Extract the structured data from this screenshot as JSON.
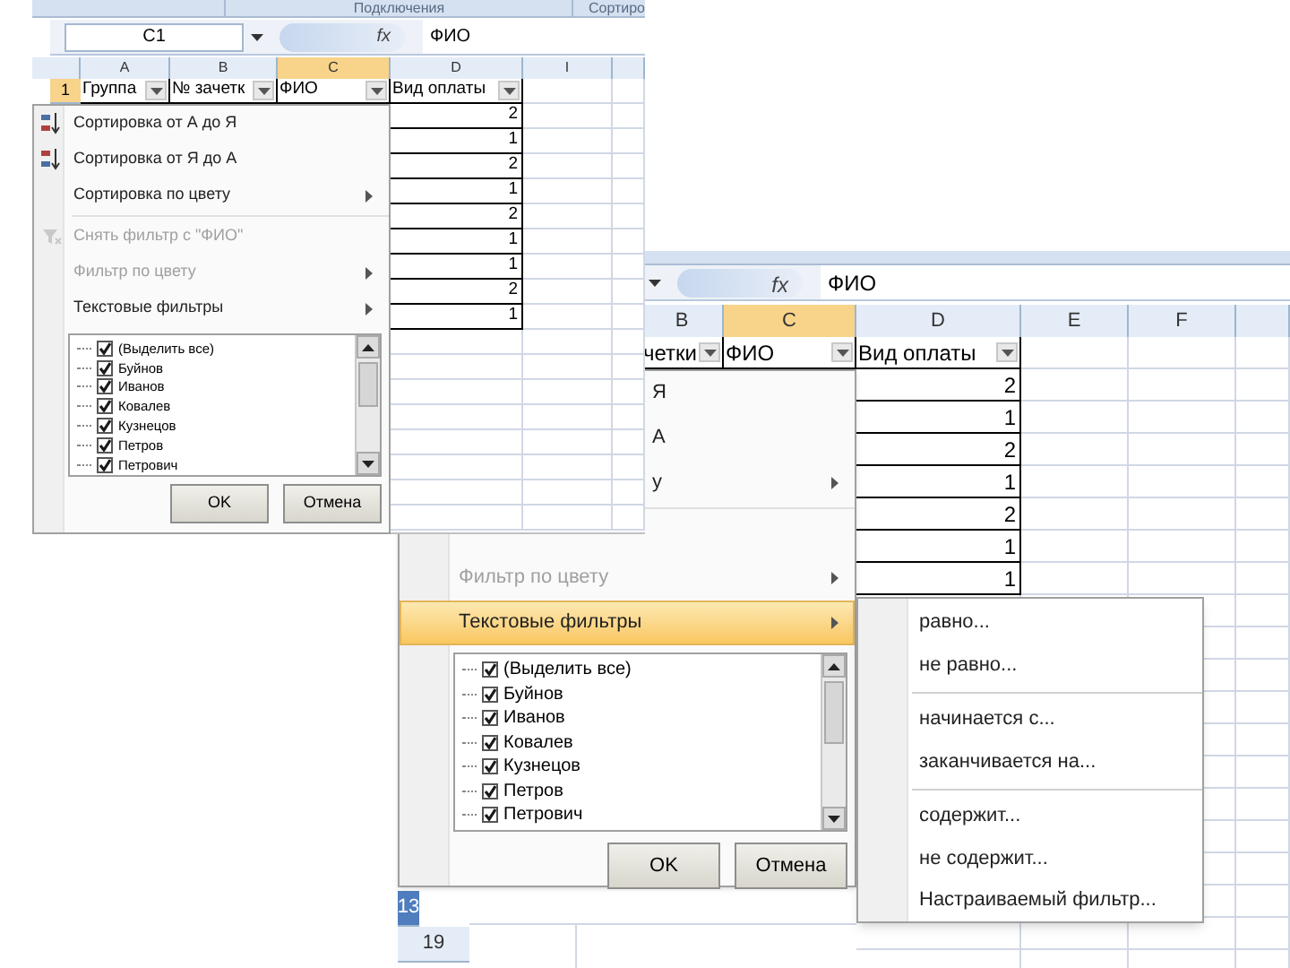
{
  "back_window": {
    "formula_bar": {
      "fx_label": "fx",
      "formula": "ФИО"
    },
    "column_headers": [
      {
        "label": "B",
        "selected": false
      },
      {
        "label": "C",
        "selected": true
      },
      {
        "label": "D",
        "selected": false
      },
      {
        "label": "E",
        "selected": false
      },
      {
        "label": "F",
        "selected": false
      }
    ],
    "header_row": [
      "четки",
      "ФИО",
      "Вид оплаты"
    ],
    "column_d_values": [
      "2",
      "1",
      "2",
      "1",
      "2",
      "1",
      "1"
    ],
    "filter_menu": {
      "items": [
        {
          "kind": "fragment",
          "label": "Я",
          "disabled": false,
          "selected": false,
          "has_submenu": false
        },
        {
          "kind": "fragment",
          "label": "А",
          "disabled": false,
          "selected": false,
          "has_submenu": false
        },
        {
          "kind": "fragment",
          "label": "у",
          "disabled": false,
          "selected": false,
          "has_submenu": true
        },
        {
          "kind": "separator"
        },
        {
          "kind": "plain",
          "label": "Фильтр по цвету",
          "disabled": true,
          "selected": false,
          "has_submenu": true
        },
        {
          "kind": "plain",
          "label": "Текстовые фильтры",
          "disabled": false,
          "selected": true,
          "has_submenu": true
        }
      ],
      "list": [
        {
          "label": "(Выделить все)",
          "checked": true
        },
        {
          "label": "Буйнов",
          "checked": true
        },
        {
          "label": "Иванов",
          "checked": true
        },
        {
          "label": "Ковалев",
          "checked": true
        },
        {
          "label": "Кузнецов",
          "checked": true
        },
        {
          "label": "Петров",
          "checked": true
        },
        {
          "label": "Петрович",
          "checked": true
        }
      ],
      "buttons": [
        "OK",
        "Отмена"
      ]
    },
    "text_filter_submenu": [
      {
        "kind": "item",
        "label": "равно..."
      },
      {
        "kind": "item",
        "label": "не равно..."
      },
      {
        "kind": "separator"
      },
      {
        "kind": "item",
        "label": "начинается с..."
      },
      {
        "kind": "item",
        "label": "заканчивается на..."
      },
      {
        "kind": "separator"
      },
      {
        "kind": "item",
        "label": "содержит..."
      },
      {
        "kind": "item",
        "label": "не содержит..."
      },
      {
        "kind": "item",
        "label": "Настраиваемый фильтр..."
      }
    ],
    "row_headers": [
      {
        "label": "13",
        "selected": true
      },
      {
        "label": "19",
        "selected": false
      }
    ]
  },
  "front_window": {
    "ribbon_tabs": [
      "Подключения",
      "Сортиро"
    ],
    "formula_bar": {
      "name_box": "C1",
      "fx_label": "fx",
      "formula": "ФИО"
    },
    "column_headers": [
      {
        "label": "A",
        "selected": false
      },
      {
        "label": "B",
        "selected": false
      },
      {
        "label": "C",
        "selected": true
      },
      {
        "label": "D",
        "selected": false
      },
      {
        "label": "I",
        "selected": false
      }
    ],
    "row_header": {
      "label": "1",
      "selected": true
    },
    "header_row": [
      "Группа",
      "№ зачетк",
      "ФИО",
      "Вид оплаты"
    ],
    "column_d_values": [
      "2",
      "1",
      "2",
      "1",
      "2",
      "1",
      "1",
      "2",
      "1"
    ],
    "filter_menu": {
      "items": [
        {
          "kind": "sort-asc",
          "label": "Сортировка от А до Я",
          "disabled": false,
          "selected": false,
          "has_submenu": false
        },
        {
          "kind": "sort-desc",
          "label": "Сортировка от Я до А",
          "disabled": false,
          "selected": false,
          "has_submenu": false
        },
        {
          "kind": "plain",
          "label": "Сортировка по цвету",
          "disabled": false,
          "selected": false,
          "has_submenu": true
        },
        {
          "kind": "separator"
        },
        {
          "kind": "clear-filter",
          "label": "Снять фильтр с \"ФИО\"",
          "disabled": true,
          "selected": false,
          "has_submenu": false
        },
        {
          "kind": "plain",
          "label": "Фильтр по цвету",
          "disabled": true,
          "selected": false,
          "has_submenu": true
        },
        {
          "kind": "plain",
          "label": "Текстовые фильтры",
          "disabled": false,
          "selected": false,
          "has_submenu": true
        }
      ],
      "list": [
        {
          "label": "(Выделить все)",
          "checked": true
        },
        {
          "label": "Буйнов",
          "checked": true
        },
        {
          "label": "Иванов",
          "checked": true
        },
        {
          "label": "Ковалев",
          "checked": true
        },
        {
          "label": "Кузнецов",
          "checked": true
        },
        {
          "label": "Петров",
          "checked": true
        },
        {
          "label": "Петрович",
          "checked": true
        }
      ],
      "buttons": [
        "OK",
        "Отмена"
      ]
    }
  }
}
